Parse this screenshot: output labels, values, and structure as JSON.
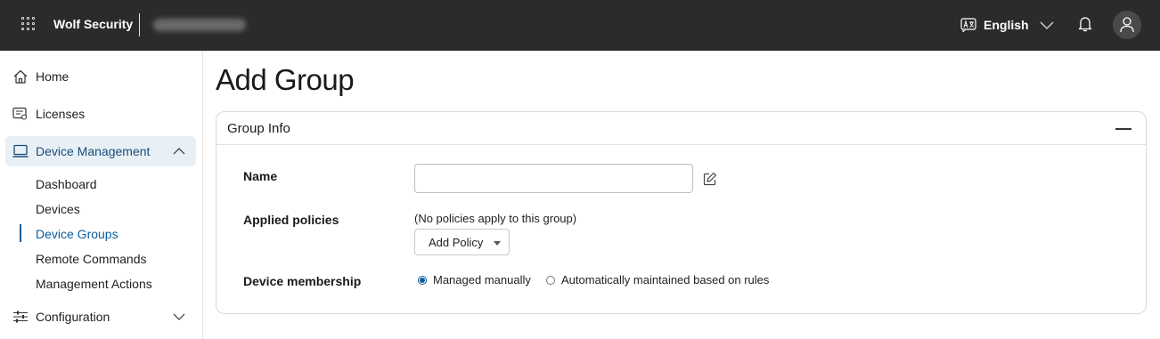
{
  "topbar": {
    "brand": "Wolf Security",
    "language": "English",
    "icons": [
      "apps-grid-icon",
      "translate-icon",
      "chevron-down-icon",
      "bell-icon",
      "user-icon"
    ]
  },
  "sidebar": {
    "items": [
      {
        "label": "Home",
        "icon": "home-icon"
      },
      {
        "label": "Licenses",
        "icon": "license-icon"
      },
      {
        "label": "Device Management",
        "icon": "laptop-icon",
        "expanded": true
      },
      {
        "label": "Configuration",
        "icon": "sliders-icon",
        "expanded": false
      }
    ],
    "sub_items": [
      "Dashboard",
      "Devices",
      "Device Groups",
      "Remote Commands",
      "Management Actions"
    ],
    "active_sub_item": "Device Groups"
  },
  "main": {
    "title": "Add Group",
    "card": {
      "title": "Group Info",
      "fields": {
        "name_label": "Name",
        "name_value": "",
        "policies_label": "Applied policies",
        "no_policies_text": "(No policies apply to this group)",
        "add_policy_label": "Add Policy",
        "membership_label": "Device membership",
        "membership_options": [
          "Managed manually",
          "Automatically maintained based on rules"
        ],
        "membership_selected": "Managed manually"
      }
    }
  },
  "colors": {
    "topbar_bg": "#2b2b2b",
    "accent": "#0a5d9e",
    "active_nav_bg": "#e8f0f6"
  }
}
